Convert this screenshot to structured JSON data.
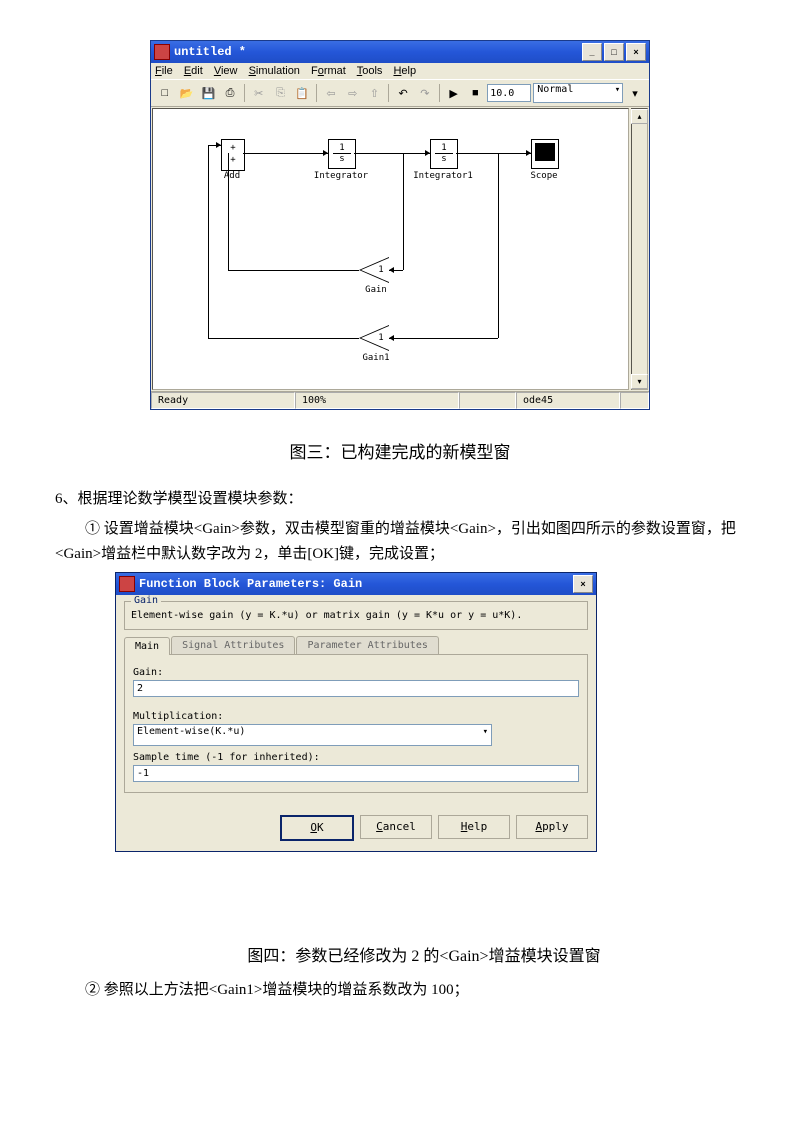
{
  "simulinkWin": {
    "title": "untitled *",
    "menu": [
      "File",
      "Edit",
      "View",
      "Simulation",
      "Format",
      "Tools",
      "Help"
    ],
    "stopTime": "10.0",
    "mode": "Normal",
    "status": {
      "ready": "Ready",
      "zoom": "100%",
      "solver": "ode45"
    },
    "blocks": {
      "add": "Add",
      "integ": "Integrator",
      "integ1": "Integrator1",
      "scope": "Scope",
      "gain": "Gain",
      "gain1": "Gain1",
      "gainVal": "1",
      "gain1Val": "1",
      "frac_num": "1",
      "frac_den": "s"
    }
  },
  "caption3": "图三：已构建完成的新模型窗",
  "para6": "6、根据理论数学模型设置模块参数：",
  "para6a": "① 设置增益模块<Gain>参数，双击模型窗重的增益模块<Gain>，引出如图四所示的参数设置窗，把<Gain>增益栏中默认数字改为 2，单击[OK]键，完成设置；",
  "gainDlg": {
    "title": "Function Block Parameters: Gain",
    "grpTitle": "Gain",
    "desc": "Element-wise gain (y = K.*u) or matrix gain (y = K*u or y = u*K).",
    "tabs": [
      "Main",
      "Signal Attributes",
      "Parameter Attributes"
    ],
    "gainLabel": "Gain:",
    "gainValue": "2",
    "multLabel": "Multiplication:",
    "multValue": "Element-wise(K.*u)",
    "sampleLabel": "Sample time (-1 for inherited):",
    "sampleValue": "-1",
    "buttons": {
      "ok": "OK",
      "cancel": "Cancel",
      "help": "Help",
      "apply": "Apply"
    }
  },
  "caption4": "图四：参数已经修改为 2 的<Gain>增益模块设置窗",
  "para6b": "② 参照以上方法把<Gain1>增益模块的增益系数改为 100；"
}
